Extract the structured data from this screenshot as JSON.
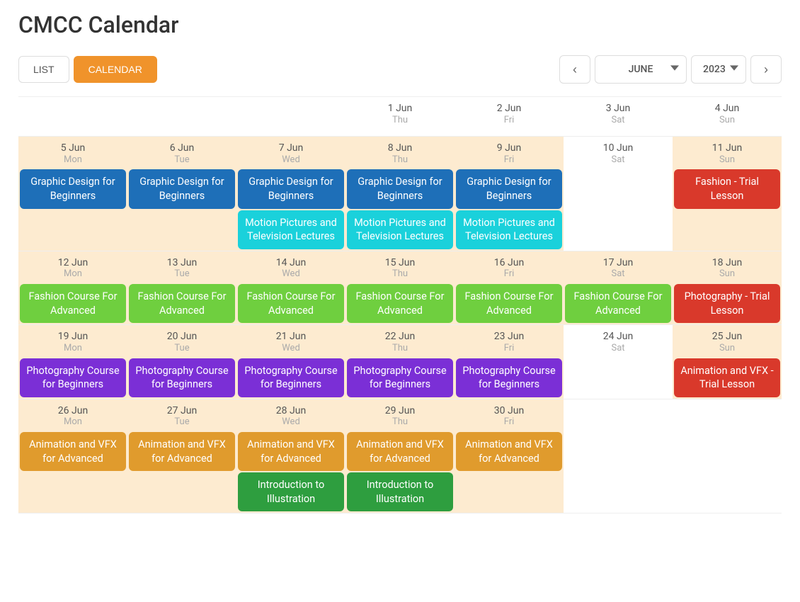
{
  "title": "CMCC Calendar",
  "toolbar": {
    "list_label": "LIST",
    "calendar_label": "CALENDAR"
  },
  "nav": {
    "prev": "‹",
    "next": "›",
    "month": "JUNE",
    "year": "2023"
  },
  "dow": {
    "Mon": "Mon",
    "Tue": "Tue",
    "Wed": "Wed",
    "Thu": "Thu",
    "Fri": "Fri",
    "Sat": "Sat",
    "Sun": "Sun"
  },
  "colors": {
    "blue": "#1e6fb8",
    "cyan": "#1ad1db",
    "green": "#6fcf3f",
    "red": "#d9392b",
    "purple": "#7b2fd6",
    "orange": "#e09b2d",
    "dgreen": "#2e9e3f",
    "page_highlight": "#fdebd0",
    "accent": "#f0932b"
  },
  "event_labels": {
    "graphic_design_beginners": "Graphic Design for Beginners",
    "motion_pictures_tv": "Motion Pictures and Television Lectures",
    "fashion_trial": "Fashion - Trial Lesson",
    "fashion_advanced": "Fashion Course For Advanced",
    "photography_trial": "Photography - Trial Lesson",
    "photography_beginners": "Photography Course for Beginners",
    "animation_vfx_trial": "Animation and VFX - Trial Lesson",
    "animation_vfx_advanced": "Animation and VFX for Advanced",
    "intro_illustration": "Introduction to Illustration"
  },
  "weeks": [
    [
      {
        "blank": true
      },
      {
        "blank": true
      },
      {
        "blank": true
      },
      {
        "date": "1 Jun",
        "dow": "Thu",
        "events": []
      },
      {
        "date": "2 Jun",
        "dow": "Fri",
        "events": []
      },
      {
        "date": "3 Jun",
        "dow": "Sat",
        "events": []
      },
      {
        "date": "4 Jun",
        "dow": "Sun",
        "events": []
      }
    ],
    [
      {
        "date": "5 Jun",
        "dow": "Mon",
        "events": [
          {
            "k": "graphic_design_beginners",
            "c": "blue"
          }
        ]
      },
      {
        "date": "6 Jun",
        "dow": "Tue",
        "events": [
          {
            "k": "graphic_design_beginners",
            "c": "blue"
          }
        ]
      },
      {
        "date": "7 Jun",
        "dow": "Wed",
        "events": [
          {
            "k": "graphic_design_beginners",
            "c": "blue"
          },
          {
            "k": "motion_pictures_tv",
            "c": "cyan"
          }
        ]
      },
      {
        "date": "8 Jun",
        "dow": "Thu",
        "events": [
          {
            "k": "graphic_design_beginners",
            "c": "blue"
          },
          {
            "k": "motion_pictures_tv",
            "c": "cyan"
          }
        ]
      },
      {
        "date": "9 Jun",
        "dow": "Fri",
        "events": [
          {
            "k": "graphic_design_beginners",
            "c": "blue"
          },
          {
            "k": "motion_pictures_tv",
            "c": "cyan"
          }
        ]
      },
      {
        "date": "10 Jun",
        "dow": "Sat",
        "events": []
      },
      {
        "date": "11 Jun",
        "dow": "Sun",
        "events": [
          {
            "k": "fashion_trial",
            "c": "red"
          }
        ]
      }
    ],
    [
      {
        "date": "12 Jun",
        "dow": "Mon",
        "events": [
          {
            "k": "fashion_advanced",
            "c": "green"
          }
        ]
      },
      {
        "date": "13 Jun",
        "dow": "Tue",
        "events": [
          {
            "k": "fashion_advanced",
            "c": "green"
          }
        ]
      },
      {
        "date": "14 Jun",
        "dow": "Wed",
        "events": [
          {
            "k": "fashion_advanced",
            "c": "green"
          }
        ]
      },
      {
        "date": "15 Jun",
        "dow": "Thu",
        "events": [
          {
            "k": "fashion_advanced",
            "c": "green"
          }
        ]
      },
      {
        "date": "16 Jun",
        "dow": "Fri",
        "events": [
          {
            "k": "fashion_advanced",
            "c": "green"
          }
        ]
      },
      {
        "date": "17 Jun",
        "dow": "Sat",
        "events": [
          {
            "k": "fashion_advanced",
            "c": "green"
          }
        ]
      },
      {
        "date": "18 Jun",
        "dow": "Sun",
        "events": [
          {
            "k": "photography_trial",
            "c": "red"
          }
        ]
      }
    ],
    [
      {
        "date": "19 Jun",
        "dow": "Mon",
        "events": [
          {
            "k": "photography_beginners",
            "c": "purple"
          }
        ]
      },
      {
        "date": "20 Jun",
        "dow": "Tue",
        "events": [
          {
            "k": "photography_beginners",
            "c": "purple"
          }
        ]
      },
      {
        "date": "21 Jun",
        "dow": "Wed",
        "events": [
          {
            "k": "photography_beginners",
            "c": "purple"
          }
        ]
      },
      {
        "date": "22 Jun",
        "dow": "Thu",
        "events": [
          {
            "k": "photography_beginners",
            "c": "purple"
          }
        ]
      },
      {
        "date": "23 Jun",
        "dow": "Fri",
        "events": [
          {
            "k": "photography_beginners",
            "c": "purple"
          }
        ]
      },
      {
        "date": "24 Jun",
        "dow": "Sat",
        "events": []
      },
      {
        "date": "25 Jun",
        "dow": "Sun",
        "events": [
          {
            "k": "animation_vfx_trial",
            "c": "red"
          }
        ]
      }
    ],
    [
      {
        "date": "26 Jun",
        "dow": "Mon",
        "events": [
          {
            "k": "animation_vfx_advanced",
            "c": "orange"
          }
        ]
      },
      {
        "date": "27 Jun",
        "dow": "Tue",
        "events": [
          {
            "k": "animation_vfx_advanced",
            "c": "orange"
          }
        ]
      },
      {
        "date": "28 Jun",
        "dow": "Wed",
        "events": [
          {
            "k": "animation_vfx_advanced",
            "c": "orange"
          },
          {
            "k": "intro_illustration",
            "c": "dgreen"
          }
        ]
      },
      {
        "date": "29 Jun",
        "dow": "Thu",
        "events": [
          {
            "k": "animation_vfx_advanced",
            "c": "orange"
          },
          {
            "k": "intro_illustration",
            "c": "dgreen"
          }
        ]
      },
      {
        "date": "30 Jun",
        "dow": "Fri",
        "events": [
          {
            "k": "animation_vfx_advanced",
            "c": "orange"
          }
        ]
      },
      {
        "blank": true
      },
      {
        "blank": true
      }
    ]
  ]
}
